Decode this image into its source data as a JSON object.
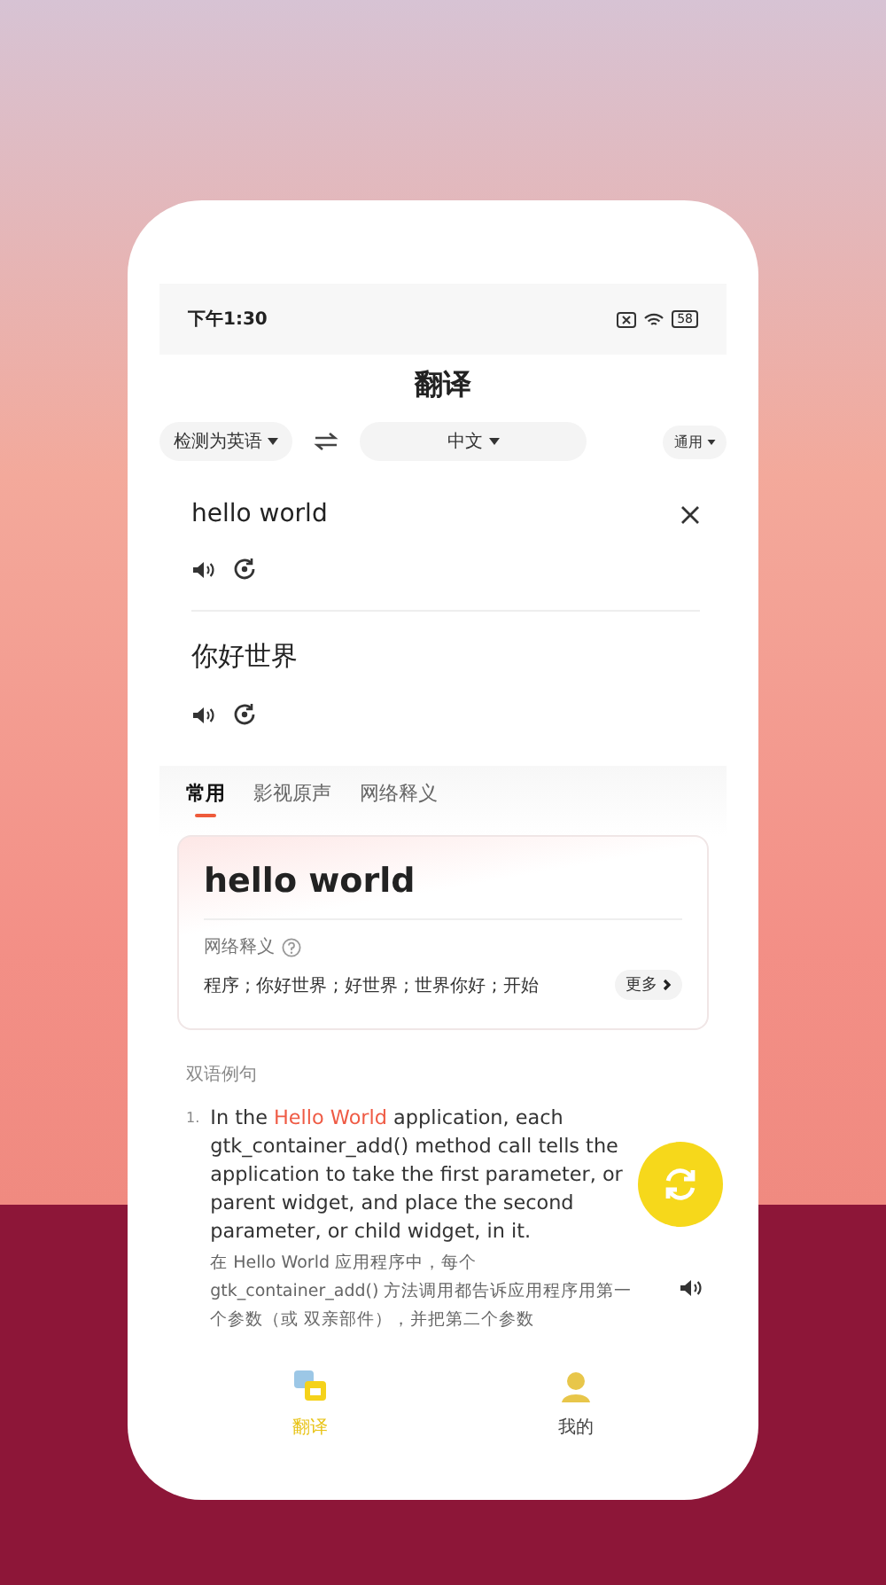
{
  "status_bar": {
    "time": "下午1:30",
    "battery": "58"
  },
  "header": {
    "title": "翻译"
  },
  "languages": {
    "source": "检测为英语",
    "target": "中文",
    "domain": "通用"
  },
  "input": {
    "value": "hello world"
  },
  "output": {
    "text": "你好世界"
  },
  "tabs": [
    {
      "label": "常用",
      "selected": true
    },
    {
      "label": "影视原声",
      "selected": false
    },
    {
      "label": "网络释义",
      "selected": false
    }
  ],
  "dictionary_card": {
    "headword": "hello world",
    "section_label": "网络释义",
    "meanings": "程序 ; 你好世界 ; 好世界 ; 世界你好 ; 开始",
    "more_button": "更多"
  },
  "examples": {
    "heading": "双语例句",
    "items": [
      {
        "number": "1.",
        "sentence": [
          {
            "text": "In the ",
            "highlight": false
          },
          {
            "text": "Hello World",
            "highlight": true
          },
          {
            "text": " application, each gtk_container_add() method call tells the application to take the first parameter, or parent widget, and place the second parameter, or child widget, in it.",
            "highlight": false
          }
        ],
        "translation": "在 Hello World 应用程序中，每个 gtk_container_add() 方法调用都告诉应用程序用第一个参数（或 双亲部件），并把第二个参数"
      }
    ]
  },
  "bottom_nav": [
    {
      "label": "翻译",
      "selected": true,
      "kind": "translate"
    },
    {
      "label": "我的",
      "selected": false,
      "kind": "profile"
    }
  ]
}
